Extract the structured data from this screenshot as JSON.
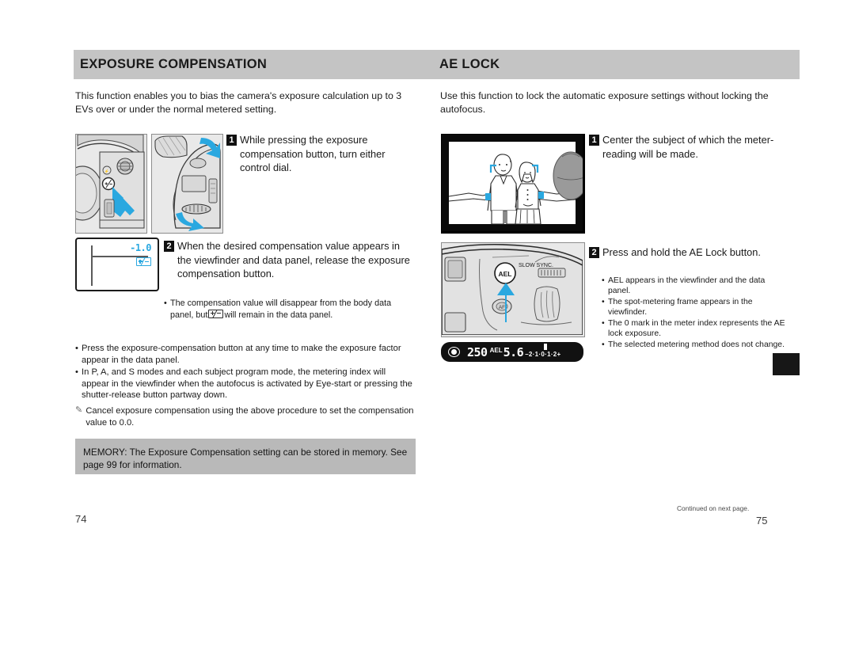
{
  "document": {
    "type": "camera-instruction-manual-spread"
  },
  "header": {
    "left_title": "EXPOSURE COMPENSATION",
    "right_title": "AE LOCK",
    "bar_color": "#c4c4c4"
  },
  "left_page": {
    "intro": "This function enables you to bias the camera's exposure calculation up to 3 EVs over or under the normal metered setting.",
    "steps": [
      {
        "number": "1",
        "text": "While pressing the exposure compensation button, turn either control dial."
      },
      {
        "number": "2",
        "text": "When the desired compensation value appears in the viewfinder and data panel, release the exposure compensation button."
      }
    ],
    "step2_bullets": [
      {
        "before": "The compensation value will disappear from the body data panel, but",
        "icon": "exposure-compensation-icon",
        "after": "will remain in the data panel."
      }
    ],
    "notes": [
      "Press the exposure-compensation button at any time to make the exposure factor appear in the data panel.",
      "In P, A, and S modes and each subject program mode, the metering index will appear in the viewfinder when the autofocus is activated by Eye-start or pressing the shutter-release button partway down."
    ],
    "pencil_note": "Cancel exposure compensation using the above procedure to set the compensation value to 0.0.",
    "memory_note": "MEMORY: The Exposure Compensation setting can be stored in memory. See page 99 for information.",
    "viewfinder": {
      "compensation_value": "-1.0",
      "icon": "exposure-compensation-icon",
      "accent_color": "#2aa8e0"
    },
    "page_number": "74"
  },
  "right_page": {
    "intro": "Use this function to lock the automatic exposure settings without locking the autofocus.",
    "steps": [
      {
        "number": "1",
        "text": "Center the subject of which the meter-reading will be made."
      },
      {
        "number": "2",
        "text": "Press and hold the AE Lock button."
      }
    ],
    "step2_bullets": [
      "AEL appears in the viewfinder and the data panel.",
      "The spot-metering frame appears in the viewfinder.",
      "The 0 mark in the meter index represents the AE lock exposure.",
      "The selected metering method does not change."
    ],
    "camera_labels": {
      "ael_button": "AEL",
      "slow_sync": "SLOW SYNC.",
      "af_button": "AF"
    },
    "lcd_panel": {
      "metering_icon": "spot-metering-icon",
      "shutter_speed": "250",
      "ael_indicator": "AEL",
      "aperture": "5.6",
      "meter_scale": "–2·1·0·1·2+",
      "index_bar_position": "0"
    },
    "continued_text": "Continued on next page.",
    "page_number": "75"
  },
  "colors": {
    "accent_cyan": "#2aa8e0",
    "header_gray": "#c4c4c4",
    "memory_gray": "#b9b9b9",
    "illustration_gray": "#e8e8e8",
    "text": "#1a1a1a"
  }
}
